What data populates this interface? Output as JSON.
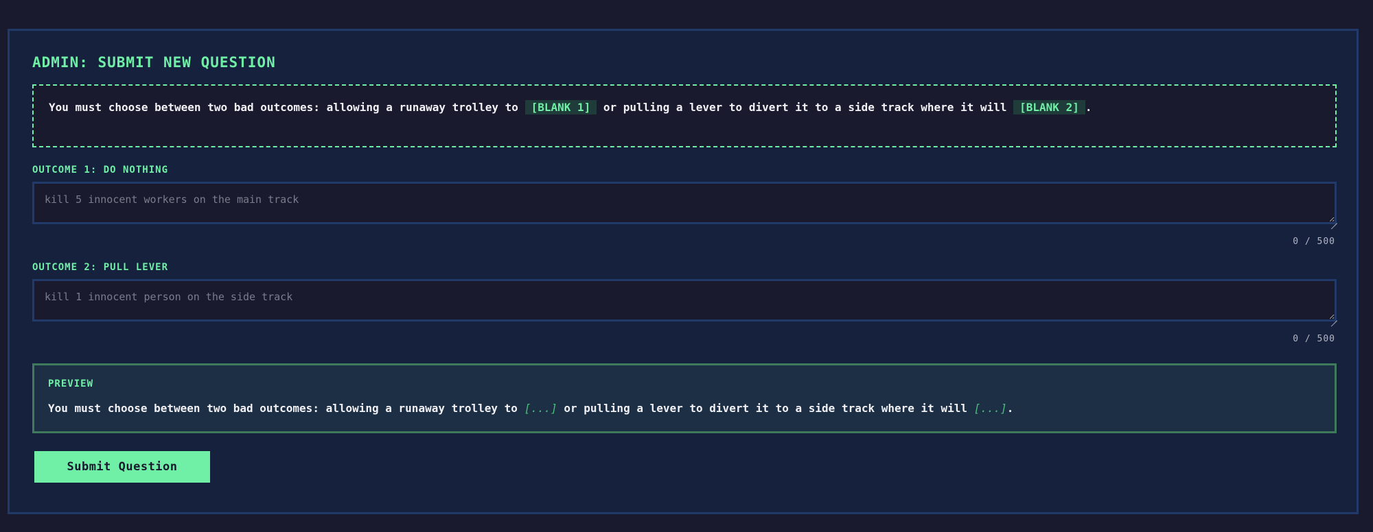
{
  "page": {
    "title": "ADMIN: SUBMIT NEW QUESTION"
  },
  "template": {
    "part1": "You must choose between two bad outcomes: allowing a runaway trolley to ",
    "blank1": "[BLANK 1]",
    "part2": " or pulling a lever to divert it to a side track where it will ",
    "blank2": "[BLANK 2]",
    "part3": "."
  },
  "outcome1": {
    "label": "OUTCOME 1: DO NOTHING",
    "value": "",
    "placeholder": "kill 5 innocent workers on the main track",
    "counter": "0 / 500"
  },
  "outcome2": {
    "label": "OUTCOME 2: PULL LEVER",
    "value": "",
    "placeholder": "kill 1 innocent person on the side track",
    "counter": "0 / 500"
  },
  "preview": {
    "label": "PREVIEW",
    "part1": "You must choose between two bad outcomes: allowing a runaway trolley to ",
    "blank1": "[...]",
    "part2": " or pulling a lever to divert it to a side track where it will ",
    "blank2": "[...]",
    "part3": "."
  },
  "actions": {
    "submit_label": "Submit Question"
  },
  "icons": {
    "textarea_resize": "resize-grip-icon"
  },
  "colors": {
    "background": "#1a1a2e",
    "panel": "#16213e",
    "accent": "#6ff0a6",
    "border": "#223a6a"
  }
}
